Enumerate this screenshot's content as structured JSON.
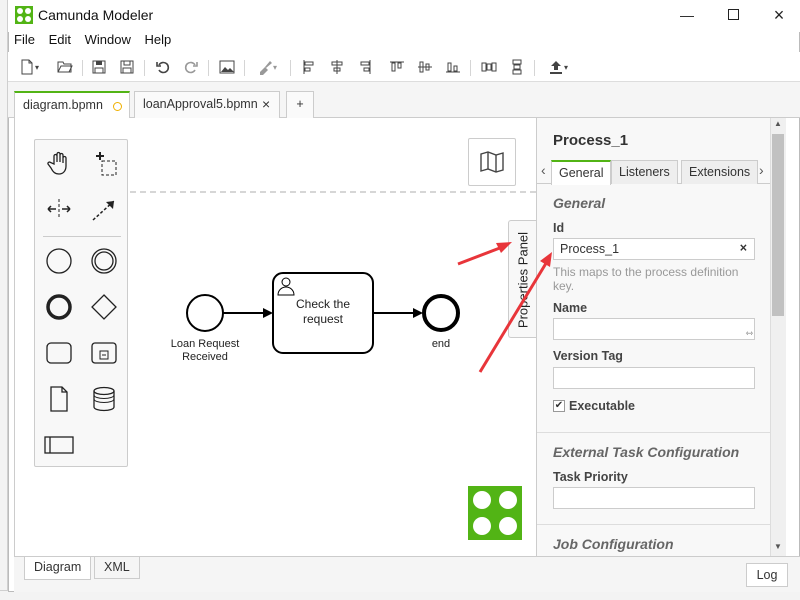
{
  "app": {
    "title": "Camunda Modeler",
    "logo_color": "#52b415"
  },
  "window_controls": [
    "minimize",
    "maximize",
    "close"
  ],
  "menu": [
    "File",
    "Edit",
    "Window",
    "Help"
  ],
  "tabs": [
    {
      "label": "diagram.bpmn",
      "status": "unsaved",
      "active": true
    },
    {
      "label": "loanApproval5.bpmn",
      "close": "×",
      "active": false
    },
    {
      "label": "+"
    }
  ],
  "diagram": {
    "start_event": "Loan Request Received",
    "task": "Check the request",
    "end_event": "end"
  },
  "properties_toggle": "Properties Panel",
  "panel": {
    "title": "Process_1",
    "nav_prev": "‹",
    "nav_next": "›",
    "tabs": [
      "General",
      "Listeners",
      "Extensions"
    ],
    "active_tab": "General",
    "general_heading": "General",
    "id_label": "Id",
    "id_value": "Process_1",
    "id_clear": "×",
    "id_hint": "This maps to the process definition key.",
    "name_label": "Name",
    "name_value": "",
    "version_label": "Version Tag",
    "version_value": "",
    "executable_label": "Executable",
    "executable_checked": true,
    "external_heading": "External Task Configuration",
    "priority_label": "Task Priority",
    "priority_value": "",
    "job_heading": "Job Configuration",
    "accent": "#52b415"
  },
  "bottom_tabs": [
    "Diagram",
    "XML"
  ],
  "log_button": "Log",
  "annotation_color": "#e8353a"
}
